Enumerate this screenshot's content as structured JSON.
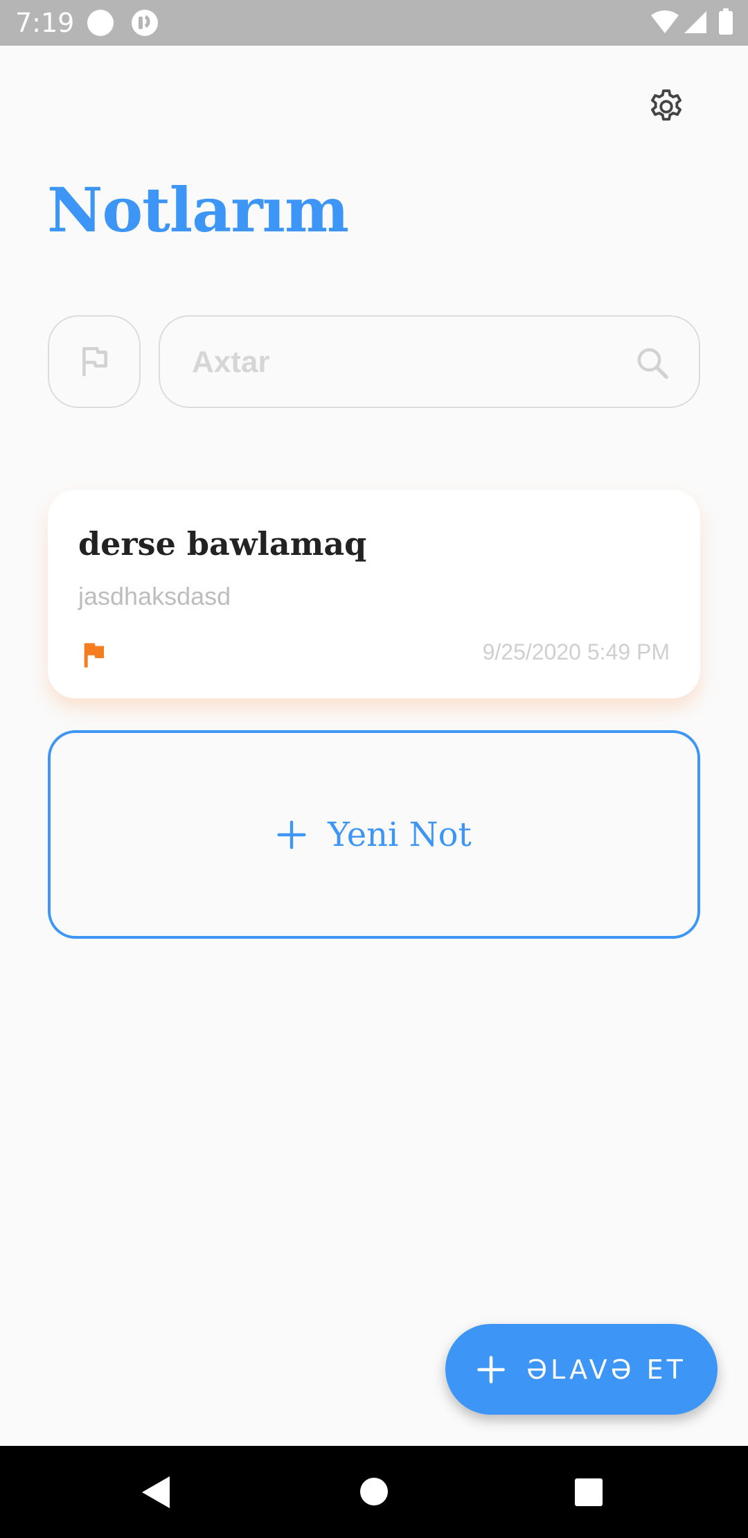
{
  "status_bar": {
    "time": "7:19"
  },
  "header": {
    "title": "Notlarım",
    "settings_icon": "gear-icon"
  },
  "search": {
    "placeholder": "Axtar",
    "value": "",
    "filter_icon": "flag-outline-icon",
    "search_icon": "search-icon"
  },
  "notes": [
    {
      "title": "derse bawlamaq",
      "body": "jasdhaksdasd",
      "date": "9/25/2020 5:49 PM",
      "flag_color": "#f57c1f"
    }
  ],
  "new_note": {
    "label": "Yeni Not"
  },
  "fab": {
    "label": "ƏLAVƏ ET"
  },
  "colors": {
    "accent": "#3d96f5",
    "flag": "#f57c1f",
    "status_bar": "#b5b5b5",
    "nav_bar": "#000000"
  }
}
